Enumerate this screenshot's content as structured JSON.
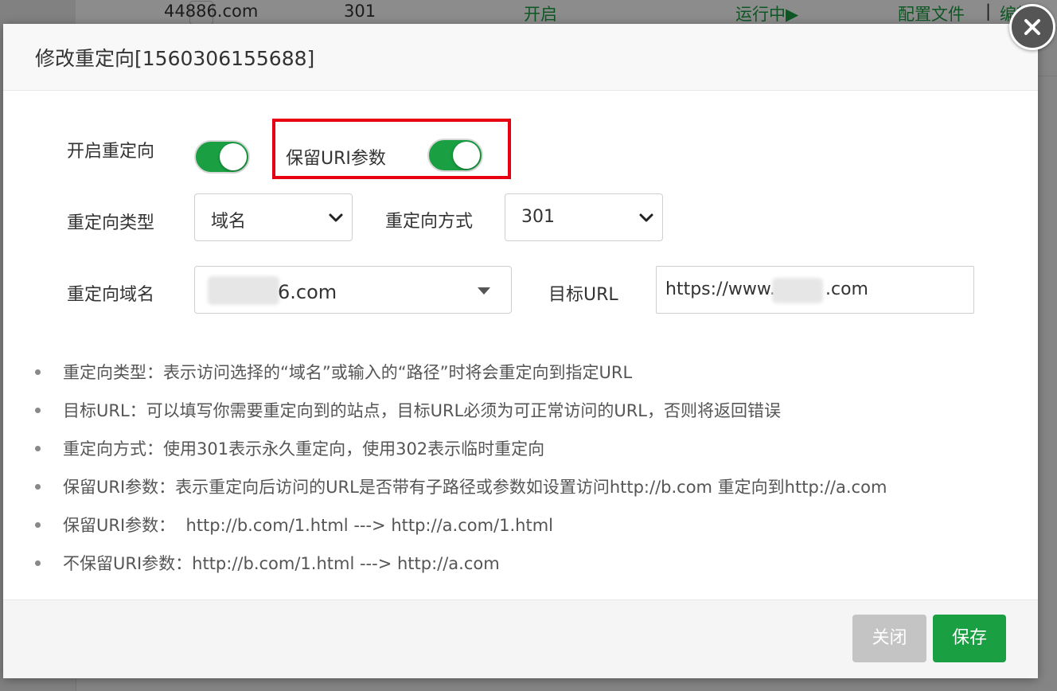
{
  "background": {
    "row": {
      "domain": "44886.com",
      "code": "301",
      "enabled": "开启",
      "status": "运行中▶",
      "config": "配置文件",
      "separator": "|",
      "edit": "编辑"
    }
  },
  "dialog": {
    "title": "修改重定向[1560306155688]",
    "fields": {
      "enable_redirect": {
        "label": "开启重定向",
        "on": true
      },
      "keep_uri_params": {
        "label": "保留URI参数",
        "on": true
      },
      "redirect_type": {
        "label": "重定向类型",
        "value": "域名"
      },
      "redirect_method": {
        "label": "重定向方式",
        "value": "301"
      },
      "redirect_domain": {
        "label": "重定向域名",
        "value": "6.com"
      },
      "target_url": {
        "label": "目标URL",
        "prefix": "https://www.4",
        "suffix": ".com"
      }
    },
    "tips": [
      "重定向类型：表示访问选择的“域名”或输入的“路径”时将会重定向到指定URL",
      "目标URL：可以填写你需要重定向到的站点，目标URL必须为可正常访问的URL，否则将返回错误",
      "重定向方式：使用301表示永久重定向，使用302表示临时重定向",
      "保留URI参数：表示重定向后访问的URL是否带有子路径或参数如设置访问http://b.com 重定向到http://a.com",
      "保留URI参数：  http://b.com/1.html ---> http://a.com/1.html",
      "不保留URI参数：http://b.com/1.html ---> http://a.com"
    ],
    "buttons": {
      "close": "关闭",
      "save": "保存"
    }
  },
  "colors": {
    "accent": "#1a9f42",
    "highlight": "#e60012",
    "disabled": "#c4c4c4"
  },
  "icons": {
    "close": "close-icon",
    "chevron": "chevron-down-icon",
    "dropdown": "caret-down-icon"
  }
}
